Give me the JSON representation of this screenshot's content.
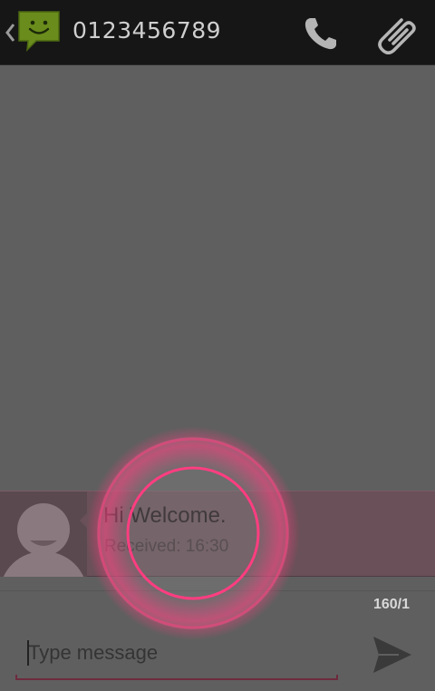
{
  "actionbar": {
    "title": "0123456789",
    "icons": {
      "back": "chevron-left-icon",
      "app": "messaging-icon",
      "call": "phone-icon",
      "attach": "paperclip-icon"
    }
  },
  "message": {
    "text": "Hi  Welcome.",
    "status": "Received: 16:30",
    "avatar_icon": "contact-avatar-icon"
  },
  "composer": {
    "counter": "160/1",
    "placeholder": "Type message",
    "send_icon": "send-icon"
  },
  "colors": {
    "actionbar": "#161616",
    "background": "#5f5f5f",
    "message_row": "#6a5058",
    "app_icon_green": "#6a8c1c",
    "touch_ring": "#ff3d80"
  }
}
